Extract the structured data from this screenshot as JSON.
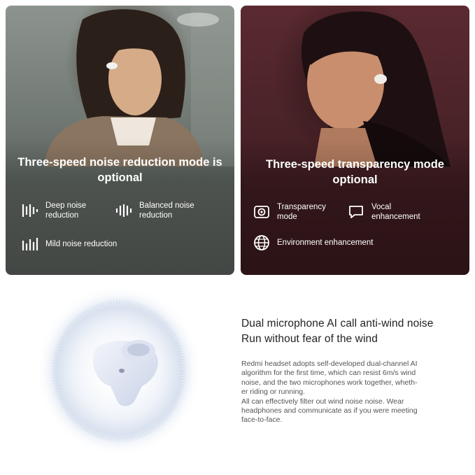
{
  "left_card": {
    "heading_line1": "Three-speed noise reduction mode is",
    "heading_line2": "optional",
    "features": [
      {
        "icon": "deep-noise-bars-icon",
        "line1": "Deep noise",
        "line2": "reduction"
      },
      {
        "icon": "balanced-noise-bars-icon",
        "line1": "Balanced noise",
        "line2": "reduction"
      },
      {
        "icon": "mild-noise-bars-icon",
        "line1": "Mild noise reduction"
      }
    ]
  },
  "right_card": {
    "heading_line1": "Three-speed transparency mode",
    "heading_line2": "optional",
    "features": [
      {
        "icon": "transparency-mode-icon",
        "line1": "Transparency",
        "line2": "mode"
      },
      {
        "icon": "speech-bubble-icon",
        "line1": "Vocal",
        "line2": "enhancement"
      },
      {
        "icon": "globe-icon",
        "line1": "Environment enhancement"
      }
    ]
  },
  "bottom_card": {
    "title_line1": "Dual microphone AI call anti-wind noise",
    "title_line2": "Run without fear of the wind",
    "body_lines": [
      "Redmi headset adopts self-developed dual-channel AI",
      "algorithm for the first time, which can resist 6m/s wind",
      "noise, and the two microphones work together, wheth-",
      "er riding or running.",
      "All can effectively filter out wind noise noise. Wear",
      "headphones and communicate as if you were meeting",
      "face-to-face."
    ]
  },
  "colors": {
    "left_bg": "#6b726d",
    "right_bg": "#4a2328",
    "text_light": "#ffffff",
    "title_dark": "#222222",
    "body_gray": "#555555"
  }
}
